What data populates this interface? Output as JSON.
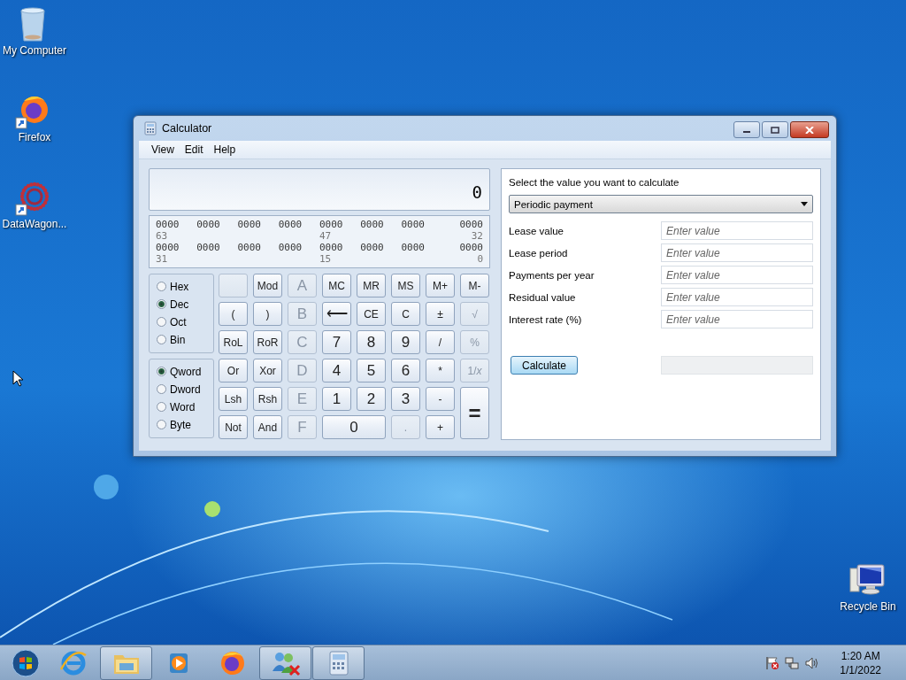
{
  "desktop": {
    "left_icons": [
      {
        "label": "My Computer",
        "kind": "trash"
      },
      {
        "label": "Firefox",
        "kind": "firefox"
      },
      {
        "label": "DataWagon...",
        "kind": "dots"
      }
    ],
    "right_icons": [
      {
        "label": "Recycle Bin",
        "kind": "monitor"
      }
    ]
  },
  "window": {
    "title": "Calculator",
    "menu": [
      "View",
      "Edit",
      "Help"
    ],
    "display": "0",
    "bits": [
      {
        "groups": [
          "0000",
          "0000",
          "0000",
          "0000",
          "0000",
          "0000",
          "0000",
          "0000"
        ],
        "labels": [
          "63",
          "47",
          "32"
        ]
      },
      {
        "groups": [
          "0000",
          "0000",
          "0000",
          "0000",
          "0000",
          "0000",
          "0000",
          "0000"
        ],
        "labels": [
          "31",
          "15",
          "0"
        ]
      }
    ],
    "base": [
      {
        "label": "Hex",
        "selected": false
      },
      {
        "label": "Dec",
        "selected": true
      },
      {
        "label": "Oct",
        "selected": false
      },
      {
        "label": "Bin",
        "selected": false
      }
    ],
    "word_size": [
      {
        "label": "Qword",
        "selected": true
      },
      {
        "label": "Dword",
        "selected": false
      },
      {
        "label": "Word",
        "selected": false
      },
      {
        "label": "Byte",
        "selected": false
      }
    ],
    "keys": [
      {
        "kind": "blank",
        "disabled": true
      },
      {
        "kind": "small",
        "label": "Mod",
        "disabled": false
      },
      {
        "kind": "large",
        "label": "A",
        "disabled": true
      },
      {
        "kind": "small",
        "label": "MC",
        "disabled": false
      },
      {
        "kind": "small",
        "label": "MR",
        "disabled": false
      },
      {
        "kind": "small",
        "label": "MS",
        "disabled": false
      },
      {
        "kind": "small",
        "label": "M+",
        "disabled": false
      },
      {
        "kind": "small",
        "label": "M-",
        "disabled": false
      },
      {
        "kind": "small",
        "label": "(",
        "disabled": false
      },
      {
        "kind": "small",
        "label": ")",
        "disabled": false
      },
      {
        "kind": "large",
        "label": "B",
        "disabled": true
      },
      {
        "kind": "large",
        "label": "⟵",
        "disabled": false
      },
      {
        "kind": "small",
        "label": "CE",
        "disabled": false
      },
      {
        "kind": "small",
        "label": "C",
        "disabled": false
      },
      {
        "kind": "small",
        "label": "±",
        "disabled": false
      },
      {
        "kind": "small",
        "label": "√",
        "disabled": true
      },
      {
        "kind": "small",
        "label": "RoL",
        "disabled": false
      },
      {
        "kind": "small",
        "label": "RoR",
        "disabled": false
      },
      {
        "kind": "large",
        "label": "C",
        "disabled": true
      },
      {
        "kind": "large",
        "label": "7",
        "disabled": false
      },
      {
        "kind": "large",
        "label": "8",
        "disabled": false
      },
      {
        "kind": "large",
        "label": "9",
        "disabled": false
      },
      {
        "kind": "small",
        "label": "/",
        "disabled": false
      },
      {
        "kind": "small",
        "label": "%",
        "disabled": true
      },
      {
        "kind": "small",
        "label": "Or",
        "disabled": false
      },
      {
        "kind": "small",
        "label": "Xor",
        "disabled": false
      },
      {
        "kind": "large",
        "label": "D",
        "disabled": true
      },
      {
        "kind": "large",
        "label": "4",
        "disabled": false
      },
      {
        "kind": "large",
        "label": "5",
        "disabled": false
      },
      {
        "kind": "large",
        "label": "6",
        "disabled": false
      },
      {
        "kind": "small",
        "label": "*",
        "disabled": false
      },
      {
        "kind": "small",
        "label": "1/*x*",
        "disabled": true
      },
      {
        "kind": "small",
        "label": "Lsh",
        "disabled": false
      },
      {
        "kind": "small",
        "label": "Rsh",
        "disabled": false
      },
      {
        "kind": "large",
        "label": "E",
        "disabled": true
      },
      {
        "kind": "large",
        "label": "1",
        "disabled": false
      },
      {
        "kind": "large",
        "label": "2",
        "disabled": false
      },
      {
        "kind": "large",
        "label": "3",
        "disabled": false
      },
      {
        "kind": "small",
        "label": "-",
        "disabled": false
      },
      {
        "kind": "tall",
        "label": "=",
        "disabled": false
      },
      {
        "kind": "small",
        "label": "Not",
        "disabled": false
      },
      {
        "kind": "small",
        "label": "And",
        "disabled": false
      },
      {
        "kind": "large",
        "label": "F",
        "disabled": true
      },
      {
        "kind": "wide",
        "label": "0",
        "disabled": false
      },
      {
        "kind": "small",
        "label": ".",
        "disabled": true
      },
      {
        "kind": "small",
        "label": "+",
        "disabled": false
      }
    ],
    "worksheet": {
      "prompt": "Select the value you want to calculate",
      "choice": "Periodic payment",
      "fields": [
        {
          "label": "Lease value",
          "placeholder": "Enter value"
        },
        {
          "label": "Lease period",
          "placeholder": "Enter value"
        },
        {
          "label": "Payments per year",
          "placeholder": "Enter value"
        },
        {
          "label": "Residual value",
          "placeholder": "Enter value"
        },
        {
          "label": "Interest rate (%)",
          "placeholder": "Enter value"
        }
      ],
      "button": "Calculate"
    }
  },
  "taskbar": {
    "items": [
      {
        "kind": "start",
        "open": false
      },
      {
        "kind": "ie",
        "open": false
      },
      {
        "kind": "folder",
        "open": true
      },
      {
        "kind": "media",
        "open": false
      },
      {
        "kind": "firefox",
        "open": false
      },
      {
        "kind": "people",
        "open": true
      },
      {
        "kind": "calculator",
        "open": true
      }
    ],
    "tray": {
      "time": "1:20 AM",
      "date": "1/1/2022"
    }
  }
}
